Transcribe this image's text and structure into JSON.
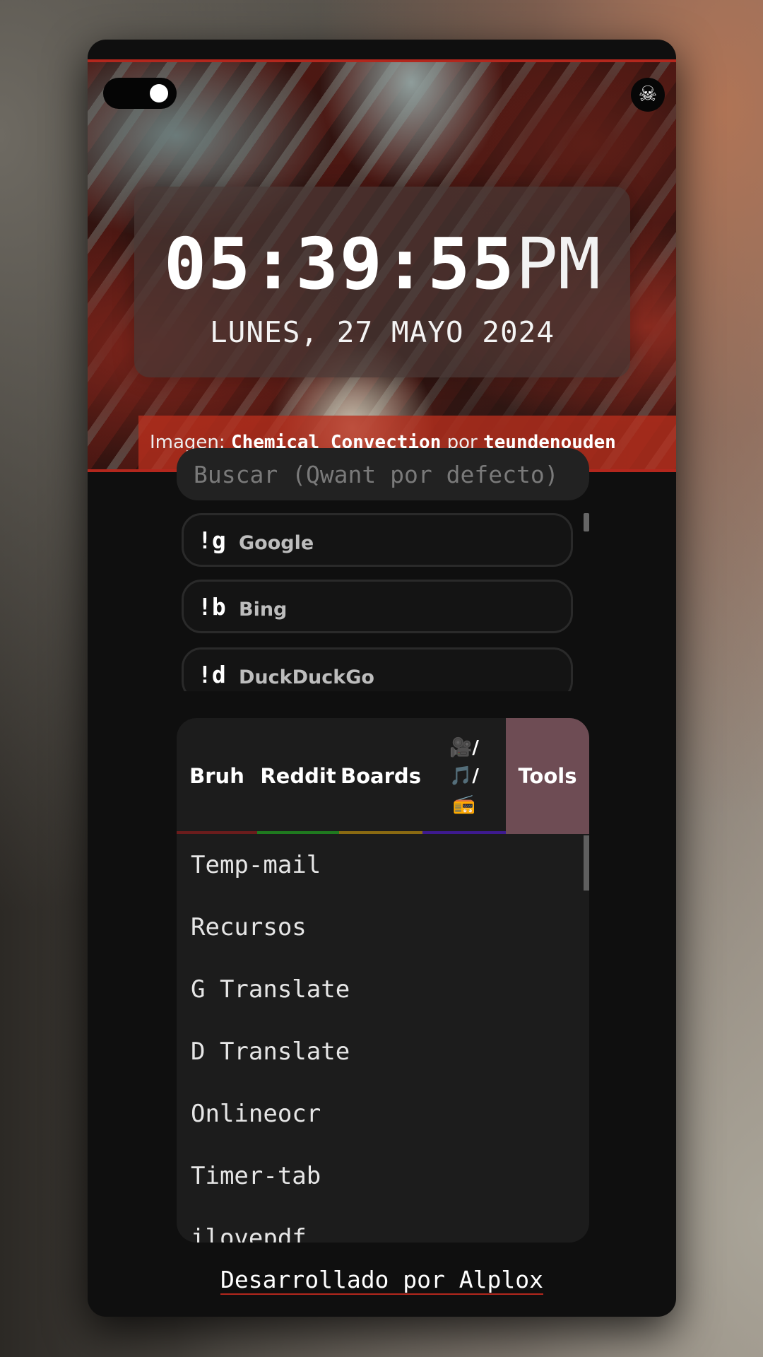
{
  "header": {
    "skull_icon": "☠",
    "time": "05:39:55",
    "ampm": "PM",
    "date": "LUNES, 27 MAYO 2024",
    "credit": {
      "prefix": "Imagen:",
      "title": "Chemical Convection",
      "by": "por",
      "author": "teundenouden"
    }
  },
  "search": {
    "placeholder": "Buscar (Qwant por defecto)"
  },
  "bangs": [
    {
      "key": "!g",
      "name": "Google"
    },
    {
      "key": "!b",
      "name": "Bing"
    },
    {
      "key": "!d",
      "name": "DuckDuckGo"
    }
  ],
  "tabs": [
    {
      "label": "Bruh",
      "color": "#6b1c1c"
    },
    {
      "label": "Reddit",
      "color": "#1f7a1f"
    },
    {
      "label": "Boards",
      "color": "#8a6a12"
    },
    {
      "label": "🎥/\n🎵/\n📻",
      "line1": "🎥/",
      "line2": "🎵/",
      "line3": "📻",
      "color": "#3d1a8f"
    },
    {
      "label": "Tools",
      "active": true,
      "color": "#6e4c54"
    }
  ],
  "tools_list": [
    "Temp-mail",
    "Recursos",
    "G Translate",
    "D Translate",
    "Onlineocr",
    "Timer-tab",
    "ilovepdf"
  ],
  "footer": "Desarrollado por Alplox",
  "colors": {
    "accent_red": "#b3271d",
    "card_bg": "#0f0f0f",
    "panel_bg": "#1c1c1c",
    "active_tab": "#6e4c54"
  }
}
